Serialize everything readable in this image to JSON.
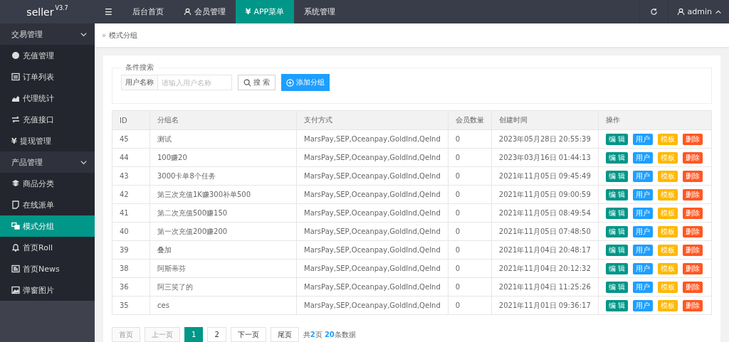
{
  "topbar": {
    "logo": "seller",
    "version": "V3.7",
    "menu_glyph": "☰",
    "items": [
      {
        "label": "后台首页",
        "icon": false,
        "selected": false
      },
      {
        "label": "会员管理",
        "icon": true,
        "selected": false
      },
      {
        "label": "APP菜单",
        "glyph": "¥",
        "icon": false,
        "selected": true
      },
      {
        "label": "系统管理",
        "icon": false,
        "selected": false
      }
    ],
    "user": "admin"
  },
  "sidebar": {
    "groups": [
      {
        "label": "交易管理",
        "expanded": true,
        "items": [
          {
            "label": "充值管理",
            "selected": false
          },
          {
            "label": "订单列表",
            "selected": false
          },
          {
            "label": "代理统计",
            "selected": false
          },
          {
            "label": "充值接口",
            "selected": false
          },
          {
            "label": "提现管理",
            "glyph": "¥",
            "selected": false
          }
        ]
      },
      {
        "label": "产品管理",
        "expanded": true,
        "items": [
          {
            "label": "商品分类",
            "selected": false
          },
          {
            "label": "在线派单",
            "selected": false
          },
          {
            "label": "模式分组",
            "selected": true
          },
          {
            "label": "首页Roll",
            "selected": false
          },
          {
            "label": "首页News",
            "selected": false
          },
          {
            "label": "弹窗图片",
            "selected": false
          }
        ]
      }
    ]
  },
  "breadcrumb": {
    "separator": "»",
    "current": "模式分组"
  },
  "search": {
    "legend": "条件搜索",
    "label": "用户名称",
    "placeholder": "请输入用户名称",
    "search_button": "搜 索",
    "add_button": "添加分组"
  },
  "table": {
    "columns": [
      "ID",
      "分组名",
      "支付方式",
      "会员数量",
      "创建时间",
      "操作"
    ],
    "rows": [
      {
        "id": "45",
        "name": "测试",
        "payment": "MarsPay,SEP,Oceanpay,GoldInd,QeInd",
        "members": "0",
        "created": "2023年05月28日 20:55:39",
        "actions": [
          {
            "kind": "edit",
            "label": "编 辑"
          },
          {
            "kind": "users",
            "label": "用户"
          },
          {
            "kind": "template",
            "label": "模板"
          },
          {
            "kind": "delete",
            "label": "删除"
          }
        ]
      },
      {
        "id": "44",
        "name": "100赚20",
        "payment": "MarsPay,SEP,Oceanpay,GoldInd,QeInd",
        "members": "0",
        "created": "2023年03月16日 01:44:13",
        "actions": [
          {
            "kind": "edit",
            "label": "编 辑"
          },
          {
            "kind": "users",
            "label": "用户"
          },
          {
            "kind": "template",
            "label": "模板"
          },
          {
            "kind": "delete",
            "label": "删除"
          }
        ]
      },
      {
        "id": "43",
        "name": "3000卡单8个任务",
        "payment": "MarsPay,SEP,Oceanpay,GoldInd,QeInd",
        "members": "0",
        "created": "2021年11月05日 09:45:49",
        "actions": [
          {
            "kind": "edit",
            "label": "编 辑"
          },
          {
            "kind": "users",
            "label": "用户"
          },
          {
            "kind": "template",
            "label": "模板"
          },
          {
            "kind": "delete",
            "label": "删除"
          }
        ]
      },
      {
        "id": "42",
        "name": "第三次充值1K赚300补单500",
        "payment": "MarsPay,SEP,Oceanpay,GoldInd,QeInd",
        "members": "0",
        "created": "2021年11月05日 09:00:59",
        "actions": [
          {
            "kind": "edit",
            "label": "编 辑"
          },
          {
            "kind": "users",
            "label": "用户"
          },
          {
            "kind": "template",
            "label": "模板"
          },
          {
            "kind": "delete",
            "label": "删除"
          }
        ]
      },
      {
        "id": "41",
        "name": "第二次充值500赚150",
        "payment": "MarsPay,SEP,Oceanpay,GoldInd,QeInd",
        "members": "0",
        "created": "2021年11月05日 08:49:54",
        "actions": [
          {
            "kind": "edit",
            "label": "编 辑"
          },
          {
            "kind": "users",
            "label": "用户"
          },
          {
            "kind": "template",
            "label": "模板"
          },
          {
            "kind": "delete",
            "label": "删除"
          }
        ]
      },
      {
        "id": "40",
        "name": "第一次充值200赚200",
        "payment": "MarsPay,SEP,Oceanpay,GoldInd,QeInd",
        "members": "0",
        "created": "2021年11月05日 07:48:50",
        "actions": [
          {
            "kind": "edit",
            "label": "编 辑"
          },
          {
            "kind": "users",
            "label": "用户"
          },
          {
            "kind": "template",
            "label": "模板"
          },
          {
            "kind": "delete",
            "label": "删除"
          }
        ]
      },
      {
        "id": "39",
        "name": "叠加",
        "payment": "MarsPay,SEP,Oceanpay,GoldInd,QeInd",
        "members": "0",
        "created": "2021年11月04日 20:48:17",
        "actions": [
          {
            "kind": "edit",
            "label": "编 辑"
          },
          {
            "kind": "users",
            "label": "用户"
          },
          {
            "kind": "template",
            "label": "模板"
          },
          {
            "kind": "delete",
            "label": "删除"
          }
        ]
      },
      {
        "id": "38",
        "name": "阿斯蒂芬",
        "payment": "MarsPay,SEP,Oceanpay,GoldInd,QeInd",
        "members": "0",
        "created": "2021年11月04日 20:12:32",
        "actions": [
          {
            "kind": "edit",
            "label": "编 辑"
          },
          {
            "kind": "users",
            "label": "用户"
          },
          {
            "kind": "template",
            "label": "模板"
          },
          {
            "kind": "delete",
            "label": "删除"
          }
        ]
      },
      {
        "id": "36",
        "name": "阿三笑了的",
        "payment": "MarsPay,SEP,Oceanpay,GoldInd,QeInd",
        "members": "0",
        "created": "2021年11月04日 11:25:26",
        "actions": [
          {
            "kind": "edit",
            "label": "编 辑"
          },
          {
            "kind": "users",
            "label": "用户"
          },
          {
            "kind": "template",
            "label": "模板"
          },
          {
            "kind": "delete",
            "label": "删除"
          }
        ]
      },
      {
        "id": "35",
        "name": "ces",
        "payment": "MarsPay,SEP,Oceanpay,GoldInd,QeInd",
        "members": "0",
        "created": "2021年11月01日 09:36:17",
        "actions": [
          {
            "kind": "edit",
            "label": "编 辑"
          },
          {
            "kind": "users",
            "label": "用户"
          },
          {
            "kind": "template",
            "label": "模板"
          },
          {
            "kind": "delete",
            "label": "删除"
          }
        ]
      }
    ]
  },
  "pagination": {
    "pages": [
      {
        "label": "首页",
        "disabled": true,
        "selected": false
      },
      {
        "label": "上一页",
        "disabled": true,
        "selected": false
      },
      {
        "label": "1",
        "disabled": false,
        "selected": true
      },
      {
        "label": "2",
        "disabled": false,
        "selected": false
      },
      {
        "label": "下一页",
        "disabled": false,
        "selected": false
      },
      {
        "label": "尾页",
        "disabled": false,
        "selected": false
      }
    ],
    "summary": "共**2**页 **20**条数据"
  }
}
